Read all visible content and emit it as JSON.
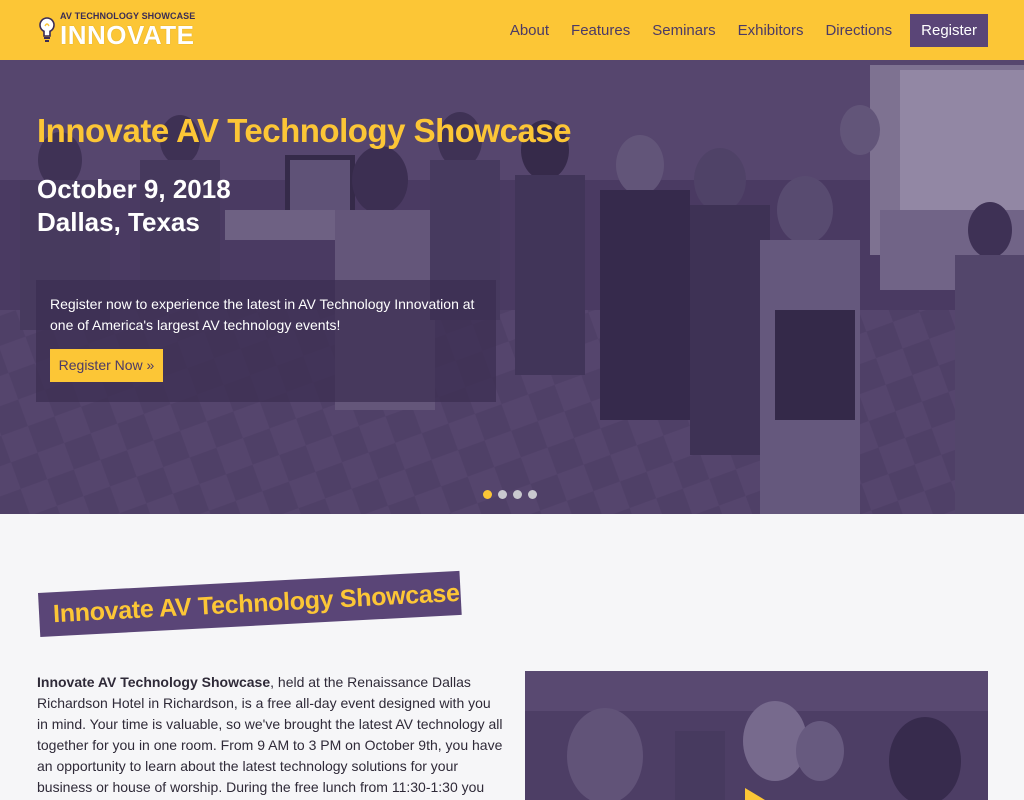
{
  "brand": {
    "small_text": "AV TECHNOLOGY SHOWCASE",
    "big_text": "INNOVATE"
  },
  "nav": {
    "items": [
      "About",
      "Features",
      "Seminars",
      "Exhibitors",
      "Directions"
    ],
    "register_label": "Register"
  },
  "hero": {
    "title": "Innovate AV Technology Showcase",
    "date": "October 9, 2018",
    "location": "Dallas, Texas",
    "description": "Register now to experience the latest in AV Technology Innovation at one of America's largest AV technology events!",
    "button_label": "Register Now »",
    "slide_count": 4,
    "active_slide": 1
  },
  "intro": {
    "heading": "Innovate AV Technology Showcase",
    "paragraph_bold": "Innovate AV Technology Showcase",
    "paragraph_rest": ", held at the Renaissance Dallas Richardson Hotel in Richardson, is a free all-day event designed with you in mind. Your time is valuable, so we've brought the latest AV technology all together for you in one room. From 9 AM to 3 PM on October 9th, you have an opportunity to learn about the latest technology solutions for your business or house of worship. During the free lunch from 11:30-1:30 you can talk to manufacturers"
  },
  "colors": {
    "accent_yellow": "#fcc636",
    "brand_purple": "#5a4577",
    "overlay_purple": "#4c3c64"
  }
}
